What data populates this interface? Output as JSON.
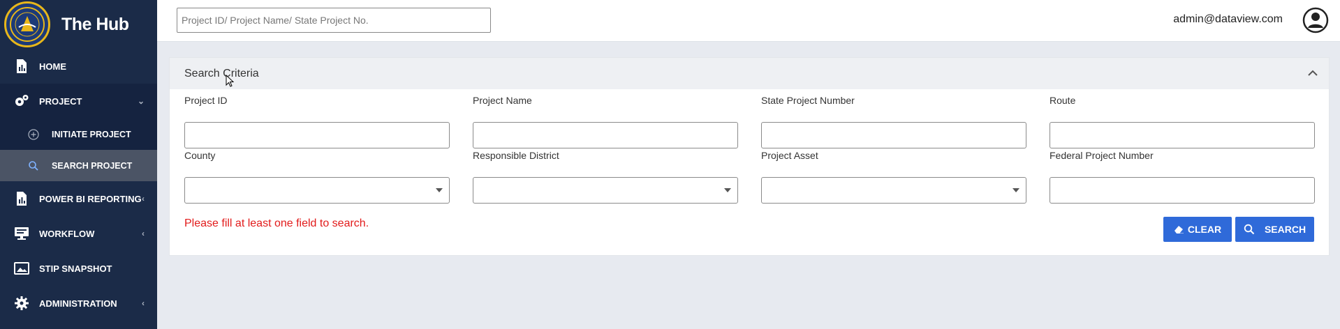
{
  "brand": {
    "title": "The Hub"
  },
  "sidebar": {
    "items": [
      {
        "label": "HOME"
      },
      {
        "label": "PROJECT",
        "caret": "⌄"
      },
      {
        "label": "INITIATE PROJECT"
      },
      {
        "label": "SEARCH PROJECT"
      },
      {
        "label": "POWER BI REPORTING",
        "caret": "‹"
      },
      {
        "label": "WORKFLOW",
        "caret": "‹"
      },
      {
        "label": "STIP SNAPSHOT"
      },
      {
        "label": "ADMINISTRATION",
        "caret": "‹"
      }
    ]
  },
  "topbar": {
    "search_placeholder": "Project ID/ Project Name/ State Project No.",
    "search_value": "",
    "user_email": "admin@dataview.com"
  },
  "panel": {
    "title": "Search Criteria",
    "fields": {
      "project_id": {
        "label": "Project ID",
        "value": ""
      },
      "project_name": {
        "label": "Project Name",
        "value": ""
      },
      "state_project_number": {
        "label": "State Project Number",
        "value": ""
      },
      "route": {
        "label": "Route",
        "value": ""
      },
      "county": {
        "label": "County",
        "value": ""
      },
      "responsible_district": {
        "label": "Responsible District",
        "value": ""
      },
      "project_asset": {
        "label": "Project Asset",
        "value": ""
      },
      "federal_project_number": {
        "label": "Federal Project Number",
        "value": ""
      }
    },
    "error_message": "Please fill at least one field to search.",
    "clear_label": "CLEAR",
    "search_label": "SEARCH"
  },
  "colors": {
    "sidebar_bg": "#1b2b48",
    "accent_blue": "#2f6ad9",
    "error_red": "#e21b1b",
    "active_item": "#4b5465"
  }
}
